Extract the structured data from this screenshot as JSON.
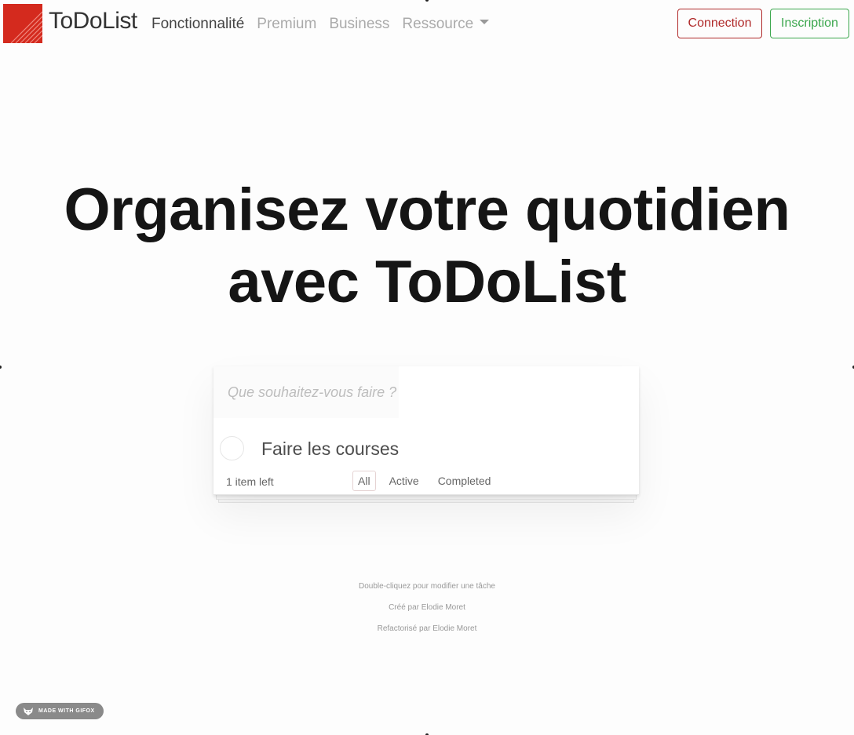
{
  "nav": {
    "brand": "ToDoList",
    "links": [
      "Fonctionnalité",
      "Premium",
      "Business",
      "Ressource"
    ],
    "login": "Connection",
    "signup": "Inscription"
  },
  "hero": {
    "line1": "Organisez votre quotidien",
    "line2": "avec ToDoList"
  },
  "todo": {
    "placeholder": "Que souhaitez-vous faire ?",
    "items": [
      {
        "label": "Faire les courses",
        "completed": false
      }
    ],
    "count": "1 item left",
    "filters": [
      "All",
      "Active",
      "Completed"
    ],
    "selected_filter": "All"
  },
  "info": {
    "hint": "Double-cliquez pour modifier une tâche",
    "created": "Créé par Elodie Moret",
    "refactored": "Refactorisé par Elodie Moret"
  },
  "badge": {
    "text": "MADE WITH GIFOX"
  },
  "colors": {
    "logo": "#d42a1e",
    "login": "#b02a2a",
    "signup": "#3aa64c"
  }
}
